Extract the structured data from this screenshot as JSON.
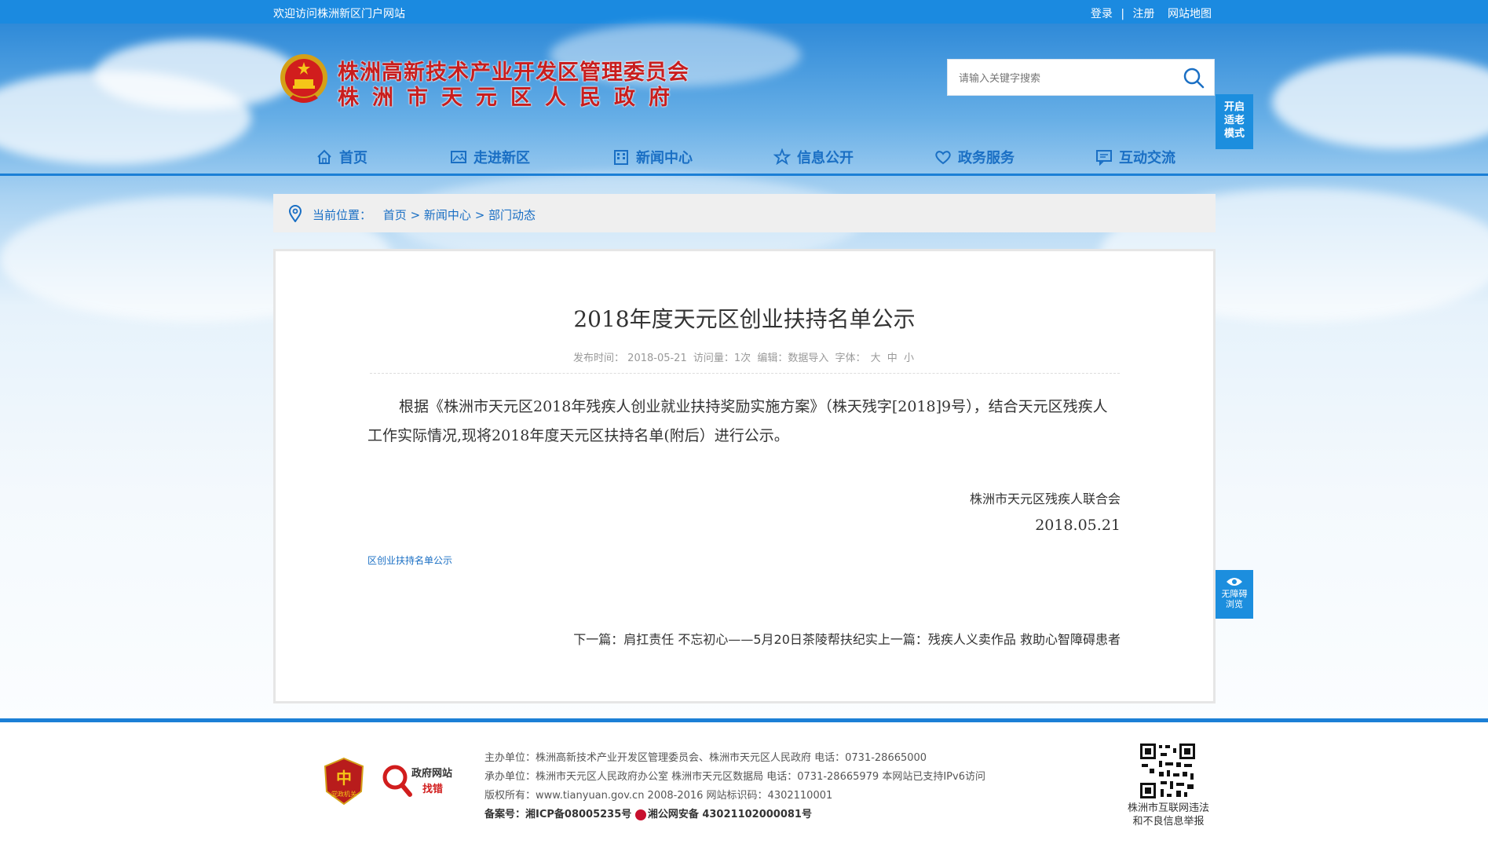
{
  "topbar": {
    "welcome": "欢迎访问株洲新区门户网站",
    "login": "登录",
    "sep": "|",
    "register": "注册",
    "sitemap": "网站地图"
  },
  "header": {
    "title_line1": "株洲高新技术产业开发区管理委员会",
    "title_line2": "株洲市天元区人民政府",
    "search_placeholder": "请输入关键字搜索"
  },
  "side": {
    "elder_mode": [
      "开启",
      "适老",
      "模式"
    ],
    "barrier_free": [
      "无障碍",
      "浏览"
    ]
  },
  "nav": [
    {
      "label": "首页",
      "icon": "home-icon"
    },
    {
      "label": "走进新区",
      "icon": "picture-icon"
    },
    {
      "label": "新闻中心",
      "icon": "building-icon"
    },
    {
      "label": "信息公开",
      "icon": "star-icon"
    },
    {
      "label": "政务服务",
      "icon": "heart-icon"
    },
    {
      "label": "互动交流",
      "icon": "chat-icon"
    }
  ],
  "breadcrumb": {
    "label": "当前位置：",
    "items": [
      "首页",
      "新闻中心",
      "部门动态"
    ],
    "sep": " > "
  },
  "article": {
    "title": "2018年度天元区创业扶持名单公示",
    "meta_time_label": "发布时间：",
    "meta_time": "2018-05-21",
    "meta_views_label": "访问量：",
    "meta_views": "1次",
    "meta_editor_label": "编辑：",
    "meta_editor": "数据导入",
    "meta_font_label": "字体：",
    "font_large": "大",
    "font_medium": "中",
    "font_small": "小",
    "paragraph": "根据《株洲市天元区2018年残疾人创业就业扶持奖励实施方案》（株天残字[2018]9号），结合天元区残疾人工作实际情况,现将2018年度天元区扶持名单(附后）进行公示。",
    "signature_org": "株洲市天元区残疾人联合会",
    "signature_date": "2018.05.21",
    "attachment": "区创业扶持名单公示",
    "next_label": "下一篇：",
    "next_title": "肩扛责任  不忘初心——5月20日茶陵帮扶纪实",
    "prev_label": "上一篇：",
    "prev_title": "残疾人义卖作品 救助心智障碍患者"
  },
  "footer": {
    "zhaocuo_top": "政府网站",
    "zhaocuo_bottom": "找错",
    "dangzheng_text": "党政机关",
    "line1": "主办单位：株洲高新技术产业开发区管理委员会、株洲市天元区人民政府 电话：0731-28665000",
    "line2": "承办单位：株洲市天元区人民政府办公室 株洲市天元区数据局 电话：0731-28665979 本网站已支持IPv6访问",
    "line3": "版权所有：www.tianyuan.gov.cn 2008-2016 网站标识码：4302110001",
    "icp": "备案号：湘ICP备08005235号",
    "police": "湘公网安备 43021102000081号",
    "report_line1": "株洲市互联网违法",
    "report_line2": "和不良信息举报"
  },
  "colors": {
    "topbar": "#1b8ae0",
    "nav_text": "#1a6fc4",
    "title_red": "#c81e1e",
    "side_button": "#1c8ede"
  }
}
